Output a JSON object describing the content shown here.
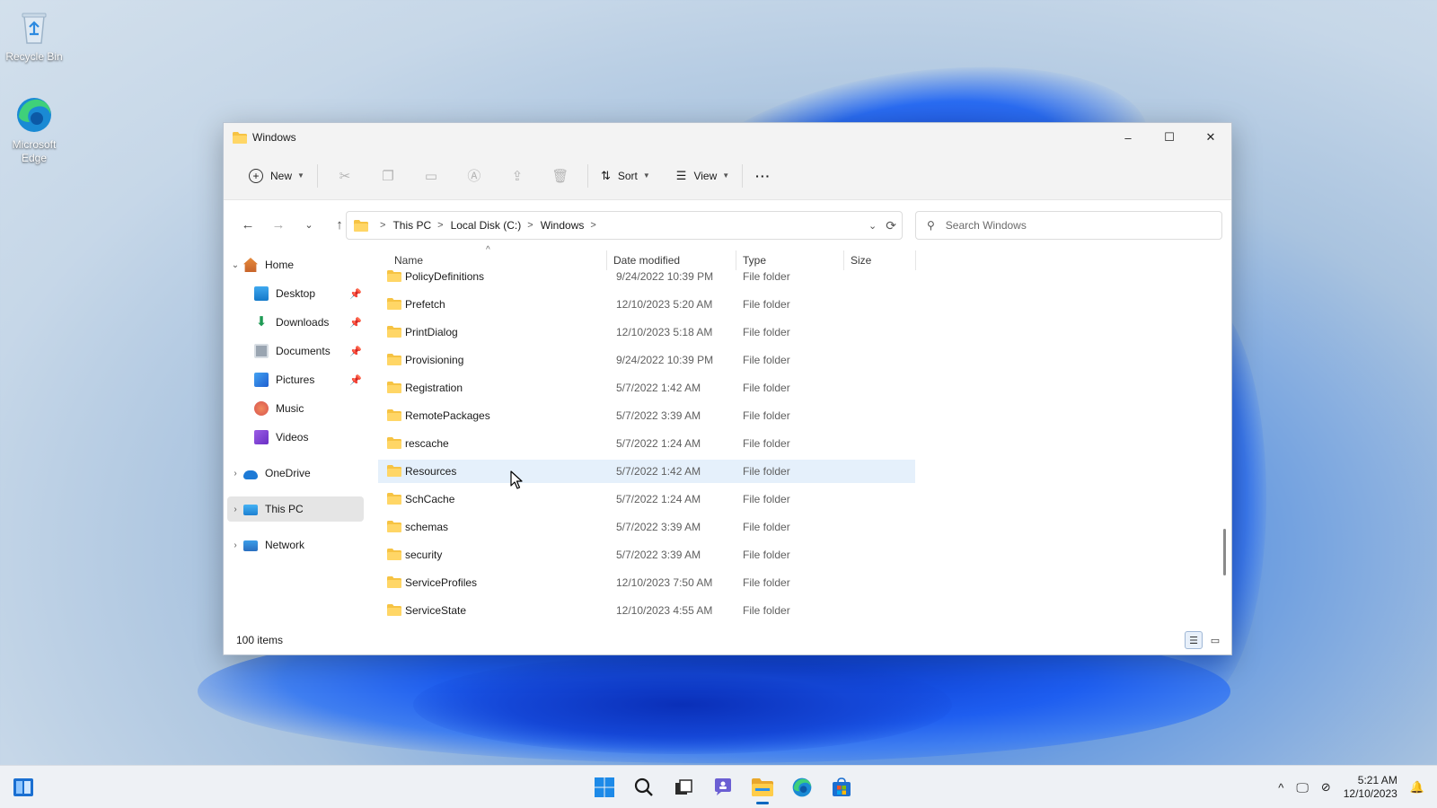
{
  "desktop": {
    "icons": [
      {
        "label": "Recycle Bin"
      },
      {
        "label": "Microsoft Edge"
      }
    ]
  },
  "window": {
    "title": "Windows",
    "controls": {
      "minimize": "–",
      "maximize": "☐",
      "close": "✕"
    }
  },
  "toolbar": {
    "new_label": "New",
    "sort_label": "Sort",
    "view_label": "View",
    "more_label": "···"
  },
  "address": {
    "crumbs": [
      "This PC",
      "Local Disk (C:)",
      "Windows"
    ]
  },
  "search": {
    "placeholder": "Search Windows"
  },
  "nav": {
    "home": "Home",
    "quick": [
      "Desktop",
      "Downloads",
      "Documents",
      "Pictures",
      "Music",
      "Videos"
    ],
    "onedrive": "OneDrive",
    "thispc": "This PC",
    "network": "Network"
  },
  "columns": {
    "name": "Name",
    "date": "Date modified",
    "type": "Type",
    "size": "Size"
  },
  "files": [
    {
      "name": "PolicyDefinitions",
      "date": "9/24/2022 10:39 PM",
      "type": "File folder"
    },
    {
      "name": "Prefetch",
      "date": "12/10/2023 5:20 AM",
      "type": "File folder"
    },
    {
      "name": "PrintDialog",
      "date": "12/10/2023 5:18 AM",
      "type": "File folder"
    },
    {
      "name": "Provisioning",
      "date": "9/24/2022 10:39 PM",
      "type": "File folder"
    },
    {
      "name": "Registration",
      "date": "5/7/2022 1:42 AM",
      "type": "File folder"
    },
    {
      "name": "RemotePackages",
      "date": "5/7/2022 3:39 AM",
      "type": "File folder"
    },
    {
      "name": "rescache",
      "date": "5/7/2022 1:24 AM",
      "type": "File folder"
    },
    {
      "name": "Resources",
      "date": "5/7/2022 1:42 AM",
      "type": "File folder"
    },
    {
      "name": "SchCache",
      "date": "5/7/2022 1:24 AM",
      "type": "File folder"
    },
    {
      "name": "schemas",
      "date": "5/7/2022 3:39 AM",
      "type": "File folder"
    },
    {
      "name": "security",
      "date": "5/7/2022 3:39 AM",
      "type": "File folder"
    },
    {
      "name": "ServiceProfiles",
      "date": "12/10/2023 7:50 AM",
      "type": "File folder"
    },
    {
      "name": "ServiceState",
      "date": "12/10/2023 4:55 AM",
      "type": "File folder"
    }
  ],
  "status": {
    "items": "100 items"
  },
  "taskbar": {
    "time": "5:21 AM",
    "date": "12/10/2023"
  },
  "colors": {
    "accent": "#0067c0",
    "folder": "#f6c343",
    "hover": "#e5f0fb"
  }
}
